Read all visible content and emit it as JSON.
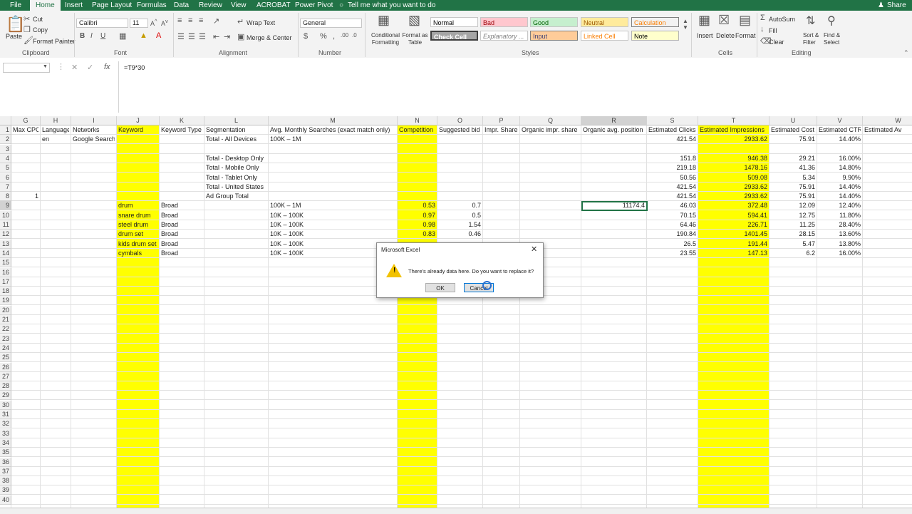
{
  "menu": [
    "File",
    "Home",
    "Insert",
    "Page Layout",
    "Formulas",
    "Data",
    "Review",
    "View",
    "ACROBAT",
    "Power Pivot"
  ],
  "tell_me": "Tell me what you want to do",
  "share": "Share",
  "ribbon": {
    "clipboard": {
      "paste": "Paste",
      "cut": "Cut",
      "copy": "Copy",
      "format_painter": "Format Painter",
      "group": "Clipboard"
    },
    "font": {
      "name": "Calibri",
      "size": "11",
      "group": "Font"
    },
    "alignment": {
      "wrap": "Wrap Text",
      "merge": "Merge & Center",
      "group": "Alignment"
    },
    "number": {
      "format": "General",
      "group": "Number"
    },
    "styles": {
      "conditional": "Conditional Formatting",
      "format_table": "Format as Table",
      "cells": [
        "Normal",
        "Bad",
        "Good",
        "Neutral",
        "Calculation",
        "Check Cell",
        "Explanatory ...",
        "Input",
        "Linked Cell",
        "Note"
      ],
      "group": "Styles"
    },
    "cells": {
      "insert": "Insert",
      "delete": "Delete",
      "format": "Format",
      "group": "Cells"
    },
    "editing": {
      "autosum": "AutoSum",
      "fill": "Fill",
      "clear": "Clear",
      "sort": "Sort & Filter",
      "find": "Find & Select",
      "group": "Editing"
    }
  },
  "formula": "=T9*30",
  "columns": [
    "G",
    "H",
    "I",
    "J",
    "K",
    "L",
    "M",
    "N",
    "O",
    "P",
    "Q",
    "R",
    "S",
    "T",
    "U",
    "V",
    "W"
  ],
  "row_numbers": [
    1,
    2,
    3,
    4,
    5,
    6,
    7,
    8,
    9,
    10,
    11,
    12,
    13,
    14,
    15,
    16,
    17,
    18,
    19,
    20,
    21,
    22,
    23,
    24,
    25,
    26,
    27,
    28,
    29,
    30,
    31,
    32,
    33,
    34,
    35,
    36,
    37,
    38,
    39,
    40
  ],
  "headers": [
    "Max CPC",
    "Language",
    "Networks",
    "Keyword",
    "Keyword Type",
    "Segmentation",
    "Avg. Monthly Searches (exact match only)",
    "Competition",
    "Suggested bid",
    "Impr. Share",
    "Organic impr. share",
    "Organic avg. position",
    "Estimated Clicks",
    "Estimated Impressions",
    "Estimated Cost",
    "Estimated CTR",
    "Estimated Av"
  ],
  "rows": [
    [
      "",
      "en",
      "Google Search",
      "",
      "",
      "Total - All Devices",
      "100K – 1M",
      "",
      "",
      "",
      "",
      "",
      "421.54",
      "2933.62",
      "75.91",
      "14.40%",
      ""
    ],
    [
      "",
      "",
      "",
      "",
      "",
      "",
      "",
      "",
      "",
      "",
      "",
      "",
      "",
      "",
      "",
      "",
      ""
    ],
    [
      "",
      "",
      "",
      "",
      "",
      "Total - Desktop Only",
      "",
      "",
      "",
      "",
      "",
      "",
      "151.8",
      "946.38",
      "29.21",
      "16.00%",
      ""
    ],
    [
      "",
      "",
      "",
      "",
      "",
      "Total - Mobile Only",
      "",
      "",
      "",
      "",
      "",
      "",
      "219.18",
      "1478.16",
      "41.36",
      "14.80%",
      ""
    ],
    [
      "",
      "",
      "",
      "",
      "",
      "Total - Tablet Only",
      "",
      "",
      "",
      "",
      "",
      "",
      "50.56",
      "509.08",
      "5.34",
      "9.90%",
      ""
    ],
    [
      "",
      "",
      "",
      "",
      "",
      "Total - United States",
      "",
      "",
      "",
      "",
      "",
      "",
      "421.54",
      "2933.62",
      "75.91",
      "14.40%",
      ""
    ],
    [
      "1",
      "",
      "",
      "",
      "",
      "Ad Group Total",
      "",
      "",
      "",
      "",
      "",
      "",
      "421.54",
      "2933.62",
      "75.91",
      "14.40%",
      ""
    ],
    [
      "",
      "",
      "",
      "drum",
      "Broad",
      "",
      "100K – 1M",
      "0.53",
      "0.7",
      "",
      "",
      "11174.4",
      "46.03",
      "372.48",
      "12.09",
      "12.40%",
      ""
    ],
    [
      "",
      "",
      "",
      "snare drum",
      "Broad",
      "",
      "10K – 100K",
      "0.97",
      "0.5",
      "",
      "",
      "",
      "70.15",
      "594.41",
      "12.75",
      "11.80%",
      ""
    ],
    [
      "",
      "",
      "",
      "steel drum",
      "Broad",
      "",
      "10K – 100K",
      "0.98",
      "1.54",
      "",
      "",
      "",
      "64.46",
      "226.71",
      "11.25",
      "28.40%",
      ""
    ],
    [
      "",
      "",
      "",
      "drum set",
      "Broad",
      "",
      "10K – 100K",
      "0.83",
      "0.46",
      "",
      "",
      "",
      "190.84",
      "1401.45",
      "28.15",
      "13.60%",
      ""
    ],
    [
      "",
      "",
      "",
      "kids drum set",
      "Broad",
      "",
      "10K – 100K",
      "",
      "",
      "",
      "",
      "",
      "26.5",
      "191.44",
      "5.47",
      "13.80%",
      ""
    ],
    [
      "",
      "",
      "",
      "cymbals",
      "Broad",
      "",
      "10K – 100K",
      "",
      "",
      "",
      "",
      "",
      "23.55",
      "147.13",
      "6.2",
      "16.00%",
      ""
    ]
  ],
  "dialog": {
    "title": "Microsoft Excel",
    "message": "There's already data here. Do you want to replace it?",
    "ok": "OK",
    "cancel": "Cancel"
  }
}
